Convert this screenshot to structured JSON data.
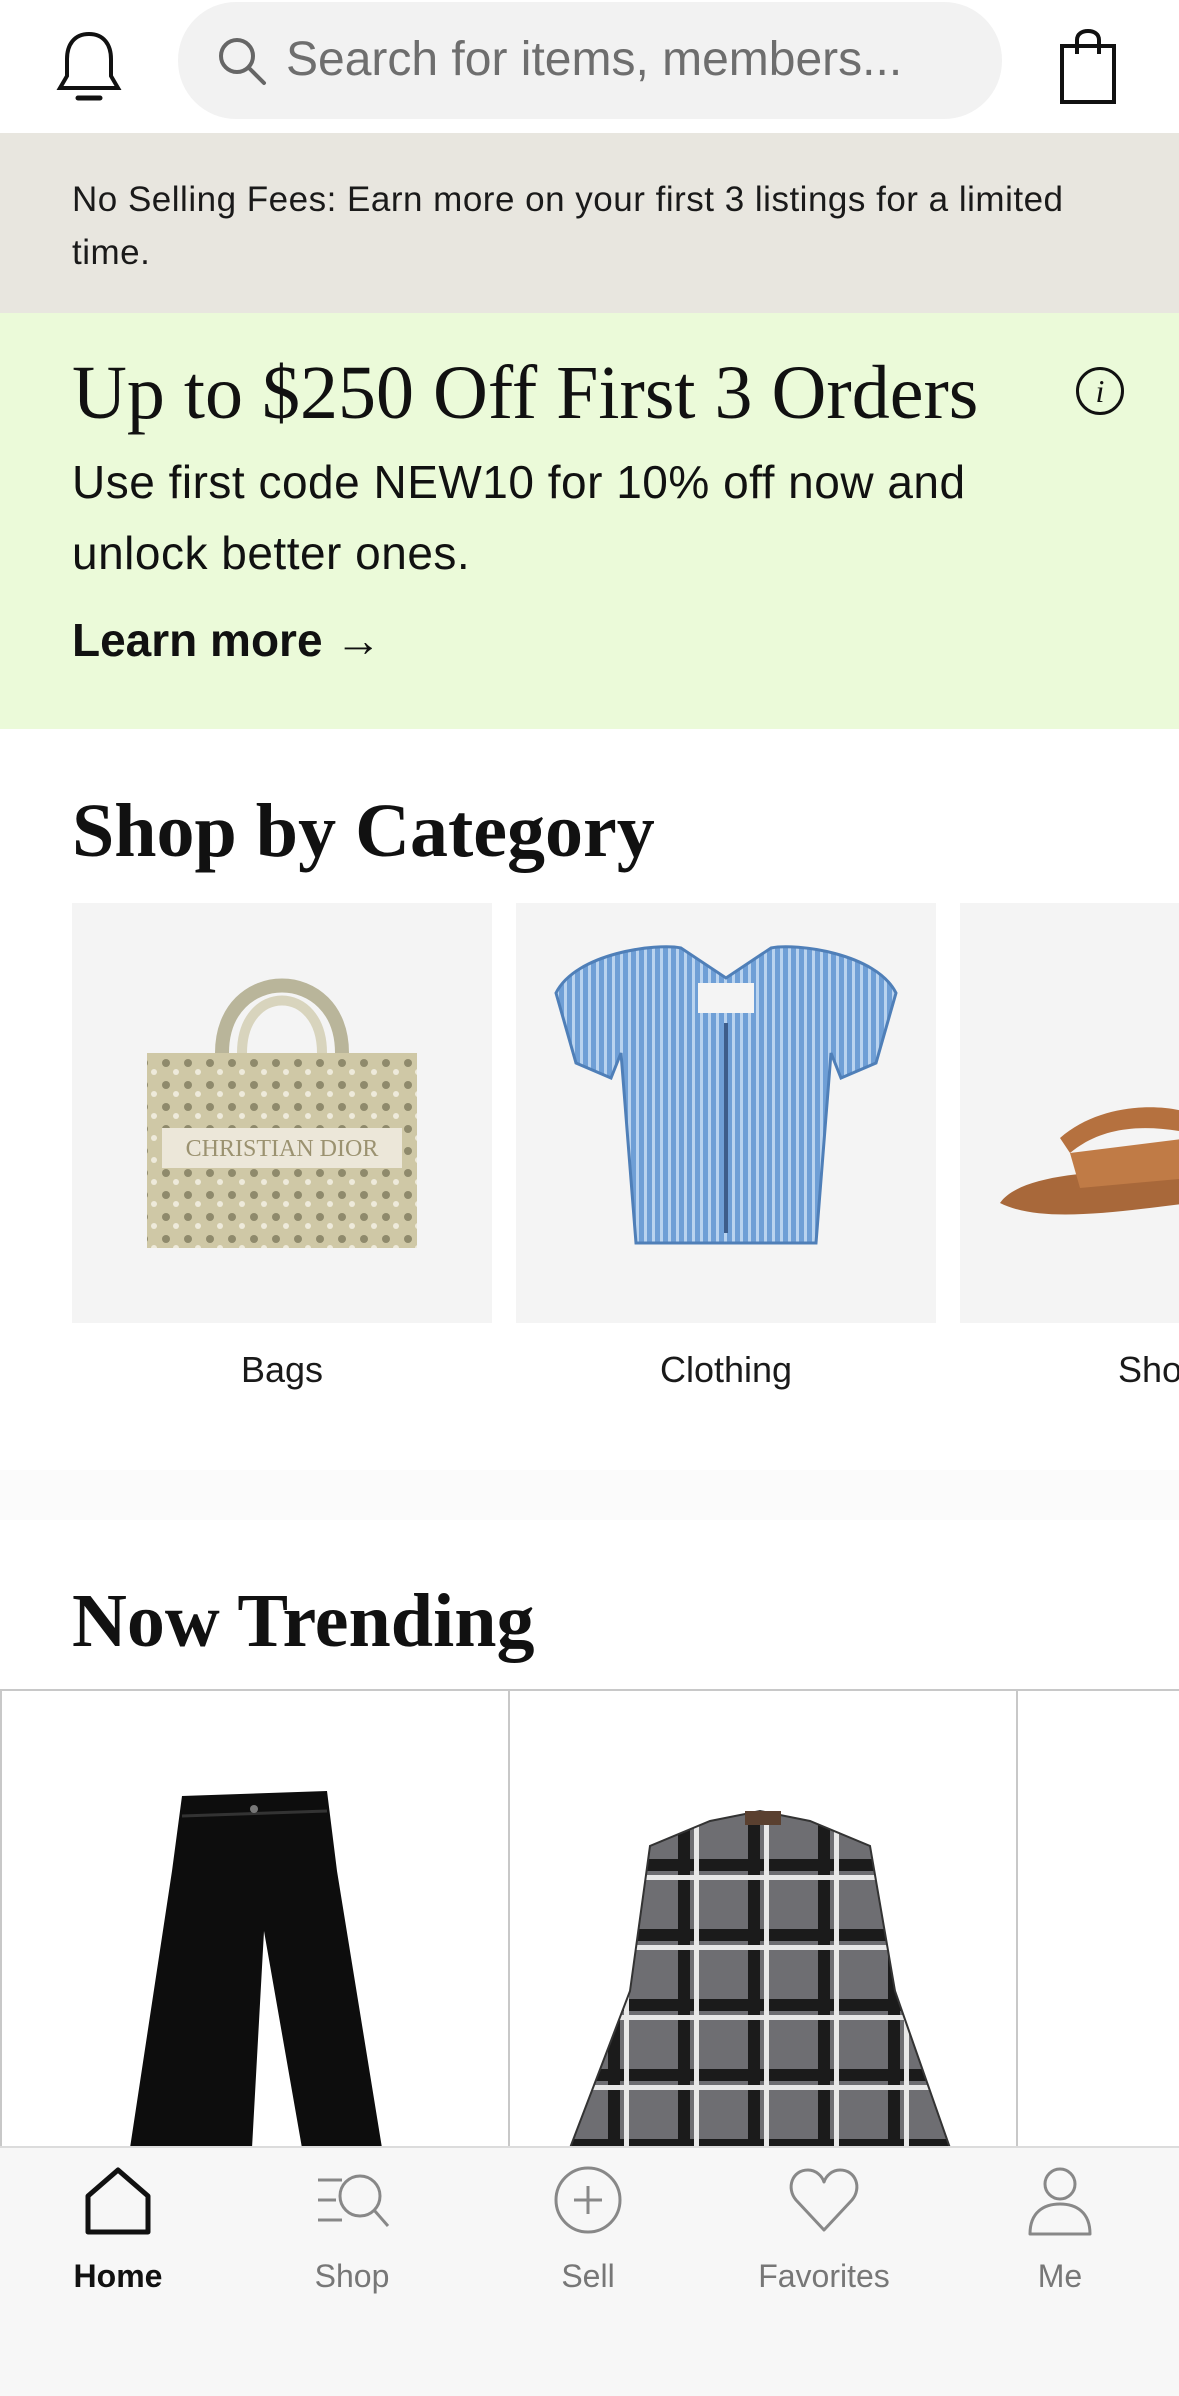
{
  "header": {
    "bell_icon": "bell-icon",
    "search_placeholder": "Search for items, members...",
    "bag_icon": "shopping-bag-icon"
  },
  "fee_banner": {
    "text": "No Selling Fees: Earn more on your first 3 listings for a limited time."
  },
  "promo": {
    "title": "Up to $250 Off First 3 Orders",
    "description": "Use first code NEW10 for 10% off now and unlock better ones.",
    "link_label": "Learn more →",
    "info_icon": "i",
    "background": "#ebfad9"
  },
  "categories": {
    "title": "Shop by Category",
    "items": [
      {
        "label": "Bags",
        "image": "tote-bag-image",
        "logo_text": "CHRISTIAN DIOR"
      },
      {
        "label": "Clothing",
        "image": "striped-blouse-image"
      },
      {
        "label": "Sho",
        "image": "sandals-image"
      }
    ]
  },
  "trending": {
    "title": "Now Trending",
    "items": [
      {
        "image": "black-jeans-image"
      },
      {
        "image": "plaid-jacket-image"
      },
      {
        "image": "product-image"
      }
    ]
  },
  "nav": {
    "items": [
      {
        "label": "Home",
        "icon": "home-icon",
        "active": true
      },
      {
        "label": "Shop",
        "icon": "shop-search-icon",
        "active": false
      },
      {
        "label": "Sell",
        "icon": "plus-circle-icon",
        "active": false
      },
      {
        "label": "Favorites",
        "icon": "heart-icon",
        "active": false
      },
      {
        "label": "Me",
        "icon": "person-icon",
        "active": false
      }
    ]
  }
}
